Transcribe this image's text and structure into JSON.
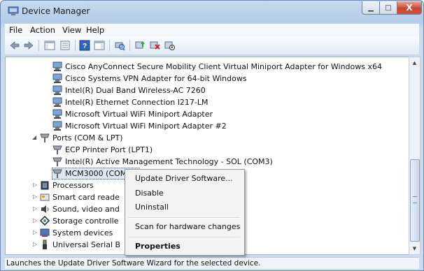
{
  "window": {
    "title": "Device Manager",
    "min_glyph": "▁",
    "max_glyph": "□",
    "close_glyph": "X"
  },
  "menubar": {
    "items": [
      "File",
      "Action",
      "View",
      "Help"
    ]
  },
  "toolbar": {
    "icons": [
      "back-arrow-icon",
      "forward-arrow-icon",
      "show-hide-console-icon",
      "properties-icon",
      "help-icon",
      "action-pane-icon",
      "scan-hardware-icon",
      "update-driver-icon",
      "uninstall-icon",
      "disable-icon"
    ]
  },
  "tree": {
    "rows": [
      {
        "label": "Cisco AnyConnect Secure Mobility Client Virtual Miniport Adapter for Windows x64",
        "icon": "network-adapter-icon"
      },
      {
        "label": "Cisco Systems VPN Adapter for 64-bit Windows",
        "icon": "network-adapter-icon"
      },
      {
        "label": "Intel(R) Dual Band Wireless-AC 7260",
        "icon": "network-adapter-icon"
      },
      {
        "label": "Intel(R) Ethernet Connection I217-LM",
        "icon": "network-adapter-icon"
      },
      {
        "label": "Microsoft Virtual WiFi Miniport Adapter",
        "icon": "network-adapter-icon"
      },
      {
        "label": "Microsoft Virtual WiFi Miniport Adapter #2",
        "icon": "network-adapter-icon"
      },
      {
        "label": "Ports (COM & LPT)",
        "icon": "port-icon",
        "expanded": true
      },
      {
        "label": "ECP Printer Port (LPT1)",
        "icon": "port-icon"
      },
      {
        "label": "Intel(R) Active Management Technology - SOL (COM3)",
        "icon": "port-icon"
      },
      {
        "label": "MCM3000 (COM9)",
        "icon": "port-icon",
        "selected": true
      },
      {
        "label": "Processors",
        "icon": "processor-icon",
        "expandable": true
      },
      {
        "label": "Smart card reade",
        "icon": "smart-card-icon",
        "expandable": true
      },
      {
        "label": "Sound, video and",
        "icon": "sound-icon",
        "expandable": true
      },
      {
        "label": "Storage controlle",
        "icon": "storage-icon",
        "expandable": true
      },
      {
        "label": "System devices",
        "icon": "system-devices-icon",
        "expandable": true
      },
      {
        "label": "Universal Serial B",
        "icon": "usb-icon",
        "expandable": true
      }
    ],
    "expand_glyph": "▷",
    "collapse_glyph": "◢"
  },
  "context_menu": {
    "items": [
      "Update Driver Software...",
      "Disable",
      "Uninstall",
      "Scan for hardware changes",
      "Properties"
    ],
    "default_item": "Properties"
  },
  "statusbar": {
    "text": "Launches the Update Driver Software Wizard for the selected device."
  },
  "scrollbar": {
    "up_glyph": "▲",
    "down_glyph": "▼"
  }
}
